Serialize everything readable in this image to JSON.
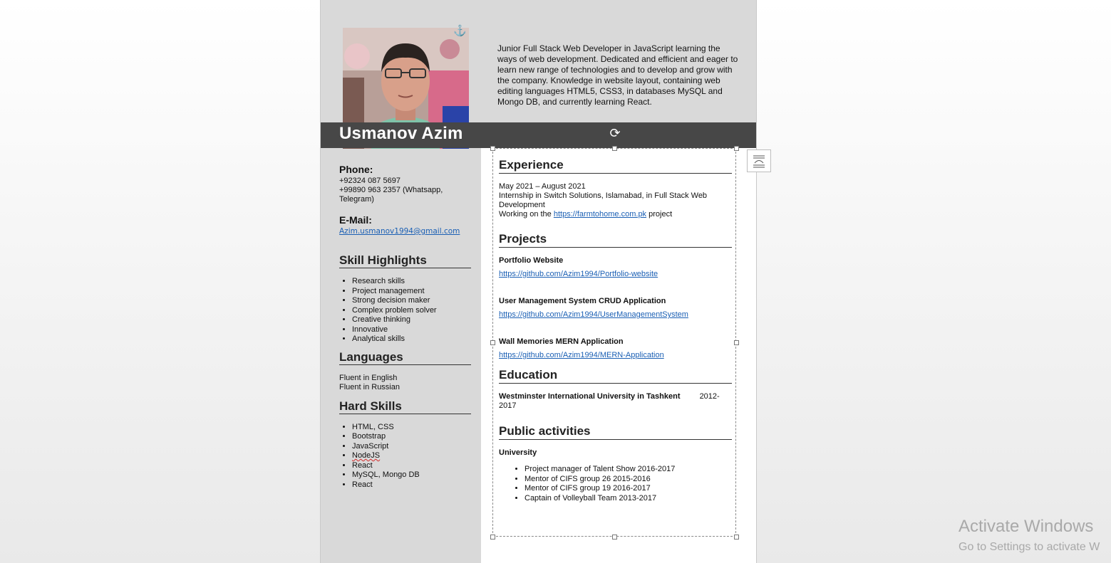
{
  "resume": {
    "name": "Usmanov Azim",
    "summary": "Junior Full Stack Web Developer in JavaScript learning the ways of web development. Dedicated and efficient and eager to learn new range of technologies and to develop and grow with the company. Knowledge in website layout, containing web editing languages HTML5, CSS3, in databases MySQL and Mongo DB, and currently learning React.",
    "phone_label": "Phone:",
    "phone_1": "+92324 087 5697",
    "phone_2": "+99890 963 2357 (Whatsapp, Telegram)",
    "email_label": "E-Mail:",
    "email": "Azim.usmanov1994@gmail.com",
    "skills_title": "Skill Highlights",
    "skills": [
      "Research skills",
      "Project management",
      "Strong decision maker",
      "Complex problem solver",
      "Creative thinking",
      "Innovative",
      "Analytical skills"
    ],
    "languages_title": "Languages",
    "languages": [
      "Fluent in English",
      "Fluent in Russian"
    ],
    "hard_skills_title": "Hard Skills",
    "hard_skills": [
      "HTML, CSS",
      "Bootstrap",
      "JavaScript",
      "NodeJS",
      "React",
      "MySQL, Mongo DB",
      "React"
    ],
    "experience_title": "Experience",
    "experience_dates": "May 2021 – August 2021",
    "experience_desc": "Internship in Switch Solutions, Islamabad, in Full Stack Web Development",
    "experience_work_prefix": "Working on the ",
    "experience_work_link": "https://farmtohome.com.pk",
    "experience_work_suffix": " project",
    "projects_title": "Projects",
    "projects": [
      {
        "name": "Portfolio Website",
        "link": "https://github.com/Azim1994/Portfolio-website"
      },
      {
        "name": "User Management System CRUD Application",
        "link": "https://github.com/Azim1994/UserManagementSystem"
      },
      {
        "name": "Wall Memories MERN Application",
        "link": "https://github.com/Azim1994/MERN-Application"
      }
    ],
    "education_title": "Education",
    "education_school": "Westminster International University in Tashkent",
    "education_years_a": "2012-",
    "education_years_b": "2017",
    "activities_title": "Public activities",
    "activities_sub": "University",
    "activities": [
      "Project manager of Talent Show 2016-2017",
      "Mentor of CIFS group 26 2015-2016",
      "Mentor of CIFS group 19 2016-2017",
      "Captain of Volleyball Team 2013-2017"
    ]
  },
  "icons": {
    "anchor": "anchor-icon",
    "rotate": "rotate-handle-icon",
    "layout_options": "layout-options-icon"
  },
  "watermark": {
    "line1": "Activate Windows",
    "line2": "Go to Settings to activate W"
  }
}
